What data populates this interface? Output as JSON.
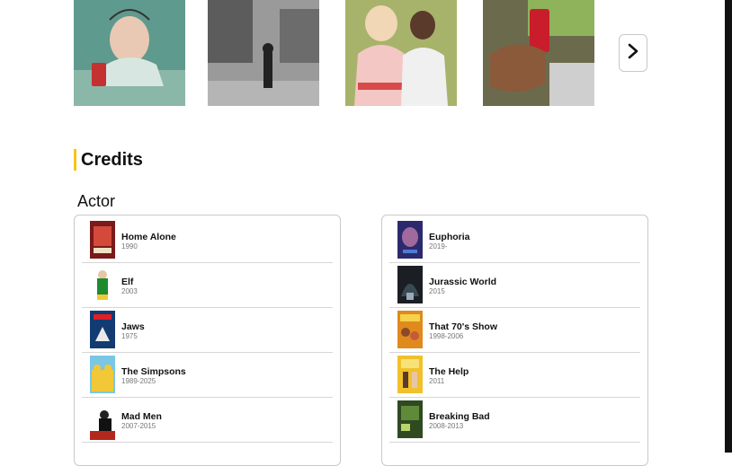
{
  "photos": [
    {
      "name": "photo-girl-soda-can",
      "colors": [
        "#5a8f86",
        "#c33131"
      ]
    },
    {
      "name": "photo-street-bw",
      "colors": [
        "#8a8a8a",
        "#222222"
      ]
    },
    {
      "name": "photo-two-women",
      "colors": [
        "#b6c07a",
        "#d84a4a"
      ]
    },
    {
      "name": "photo-hand-soda-can",
      "colors": [
        "#6f6a4d",
        "#c91d2b"
      ]
    }
  ],
  "credits": {
    "title": "Credits",
    "section": "Actor",
    "left": [
      {
        "title": "Home Alone",
        "years": "1990",
        "poster_color": "#7a1a1a"
      },
      {
        "title": "Elf",
        "years": "2003",
        "poster_color": "#1f8b2f"
      },
      {
        "title": "Jaws",
        "years": "1975",
        "poster_color": "#123b72"
      },
      {
        "title": "The Simpsons",
        "years": "1989-2025",
        "poster_color": "#f2c838"
      },
      {
        "title": "Mad Men",
        "years": "2007-2015",
        "poster_color": "#b3281e"
      }
    ],
    "right": [
      {
        "title": "Euphoria",
        "years": "2019-",
        "poster_color": "#3a2f7a"
      },
      {
        "title": "Jurassic World",
        "years": "2015",
        "poster_color": "#1b1f24"
      },
      {
        "title": "That 70's Show",
        "years": "1998-2006",
        "poster_color": "#e08a1e"
      },
      {
        "title": "The Help",
        "years": "2011",
        "poster_color": "#f0c12b"
      },
      {
        "title": "Breaking Bad",
        "years": "2008-2013",
        "poster_color": "#3f6b2b"
      }
    ]
  }
}
